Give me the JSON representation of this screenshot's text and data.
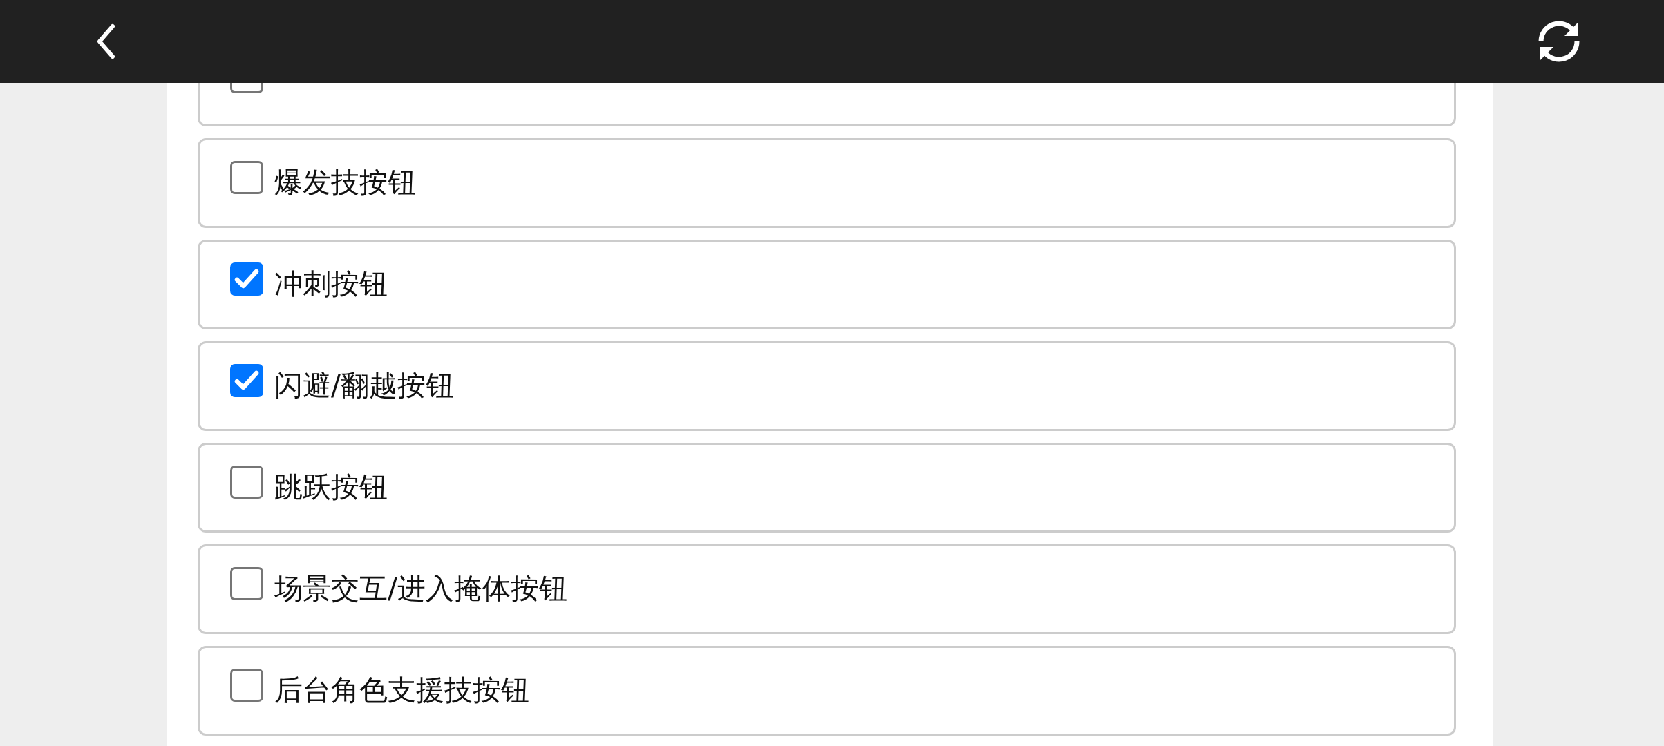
{
  "clipped_option": {
    "checked": false
  },
  "options": [
    {
      "label": "爆发技按钮",
      "checked": false
    },
    {
      "label": "冲刺按钮",
      "checked": true
    },
    {
      "label": "闪避/翻越按钮",
      "checked": true
    },
    {
      "label": "跳跃按钮",
      "checked": false
    },
    {
      "label": "场景交互/进入掩体按钮",
      "checked": false
    },
    {
      "label": "后台角色支援技按钮",
      "checked": false
    }
  ]
}
